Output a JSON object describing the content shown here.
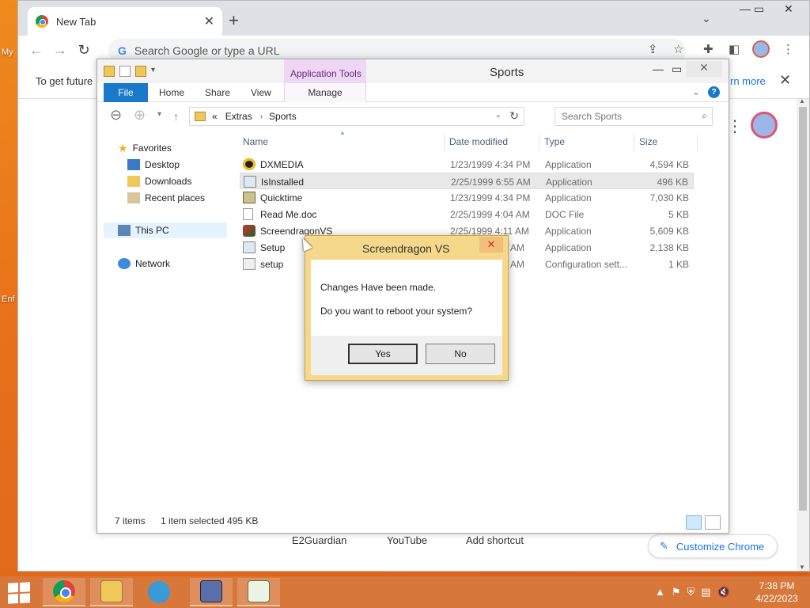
{
  "desktop": {
    "icon_labels": [
      "My",
      "Enf"
    ]
  },
  "chrome": {
    "tab_title": "New Tab",
    "omnibox_placeholder": "Search Google or type a URL",
    "info_bar_text": "To get future",
    "info_bar_link": "rn more",
    "shortcuts": [
      "E2Guardian",
      "YouTube",
      "Add shortcut"
    ],
    "customize_label": "Customize Chrome"
  },
  "explorer": {
    "window_title": "Sports",
    "contextual_tab_group": "Application Tools",
    "ribbon_tabs": [
      "File",
      "Home",
      "Share",
      "View",
      "Manage"
    ],
    "address": {
      "overflow": "«",
      "segments": [
        "Extras",
        "Sports"
      ]
    },
    "search_placeholder": "Search Sports",
    "nav_pane": {
      "favorites": "Favorites",
      "favorites_items": [
        "Desktop",
        "Downloads",
        "Recent places"
      ],
      "this_pc": "This PC",
      "network": "Network"
    },
    "columns": [
      "Name",
      "Date modified",
      "Type",
      "Size"
    ],
    "files": [
      {
        "name": "DXMEDIA",
        "date": "1/23/1999 4:34 PM",
        "type": "Application",
        "size": "4,594 KB",
        "icon": "dxmedia-icon"
      },
      {
        "name": "IsInstalled",
        "date": "2/25/1999 6:55 AM",
        "type": "Application",
        "size": "496 KB",
        "icon": "app-icon"
      },
      {
        "name": "Quicktime",
        "date": "1/23/1999 4:34 PM",
        "type": "Application",
        "size": "7,030 KB",
        "icon": "installer-icon"
      },
      {
        "name": "Read Me.doc",
        "date": "2/25/1999 4:04 AM",
        "type": "DOC File",
        "size": "5 KB",
        "icon": "document-icon"
      },
      {
        "name": "ScreendragonVS",
        "date": "2/25/1999 4:11 AM",
        "type": "Application",
        "size": "5,609 KB",
        "icon": "screendragon-icon"
      },
      {
        "name": "Setup",
        "date": "AM",
        "type": "Application",
        "size": "2,138 KB",
        "icon": "setup-icon"
      },
      {
        "name": "setup",
        "date": "AM",
        "type": "Configuration sett...",
        "size": "1 KB",
        "icon": "config-icon"
      }
    ],
    "status": {
      "item_count": "7 items",
      "selection": "1 item selected  495 KB"
    }
  },
  "dialog": {
    "title": "Screendragon VS",
    "message_1": "Changes Have been made.",
    "message_2": "Do you want to reboot your system?",
    "yes_label": "Yes",
    "no_label": "No"
  },
  "taskbar": {
    "time": "7:38 PM",
    "date": "4/22/2023"
  }
}
